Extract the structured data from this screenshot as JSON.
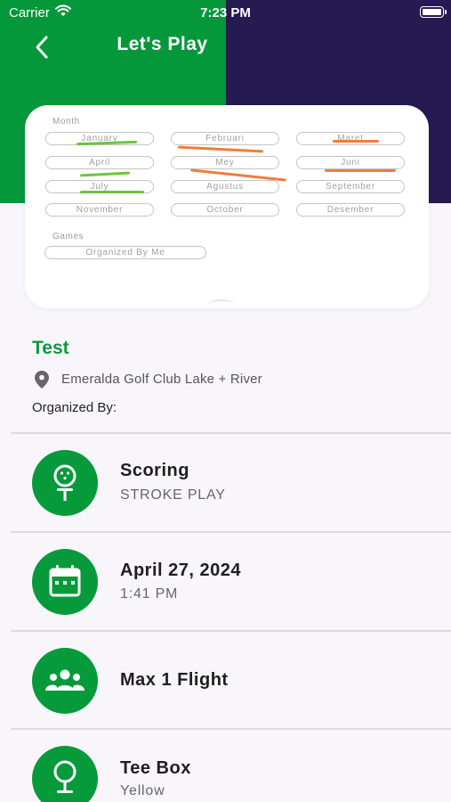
{
  "status_bar": {
    "carrier": "Carrier",
    "time": "7:23 PM"
  },
  "header": {
    "title": "Let's Play"
  },
  "filter_card": {
    "month_label": "Month",
    "months": [
      "January",
      "Februari",
      "Maret",
      "April",
      "Mey",
      "Juni",
      "July",
      "Agustus",
      "September",
      "November",
      "October",
      "Desember"
    ],
    "games_label": "Games",
    "games": [
      "Organized By Me"
    ]
  },
  "event": {
    "name": "Test",
    "location": "Emeralda Golf Club Lake + River",
    "organized_by_label": "Organized By:"
  },
  "details": [
    {
      "title": "Scoring",
      "subtitle": "STROKE PLAY",
      "icon": "golf-ball-on-tee-icon"
    },
    {
      "title": "April 27, 2024",
      "subtitle": "1:41 PM",
      "icon": "calendar-icon"
    },
    {
      "title": "Max 1 Flight",
      "subtitle": "",
      "icon": "group-icon"
    },
    {
      "title": "Tee Box",
      "subtitle": "Yellow",
      "icon": "tee-icon"
    }
  ],
  "colors": {
    "green": "#05983a",
    "navy": "#261a52",
    "accent_green": "#0e9a3d",
    "scribble_green": "#6cc441",
    "scribble_orange": "#ef7d3f"
  }
}
